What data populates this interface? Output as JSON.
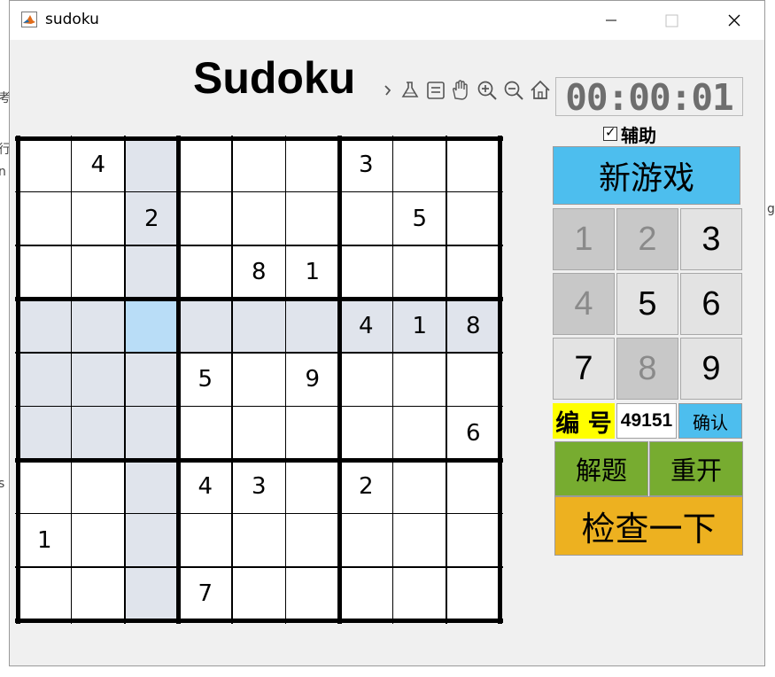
{
  "window": {
    "title": "sudoku"
  },
  "background": {
    "fragments": [
      "考",
      "行",
      "n",
      "go",
      "s"
    ]
  },
  "heading": "Sudoku",
  "timer": "00:00:01",
  "assist": {
    "label": "辅助",
    "checked": true
  },
  "buttons": {
    "new_game": "新游戏",
    "confirm": "确认",
    "solve": "解题",
    "restart": "重开",
    "check": "检查一下"
  },
  "puzzle_id": {
    "label": "编 号",
    "value": "49151"
  },
  "numpad": [
    {
      "label": "1",
      "enabled": false
    },
    {
      "label": "2",
      "enabled": false
    },
    {
      "label": "3",
      "enabled": true
    },
    {
      "label": "4",
      "enabled": false
    },
    {
      "label": "5",
      "enabled": true
    },
    {
      "label": "6",
      "enabled": true
    },
    {
      "label": "7",
      "enabled": true
    },
    {
      "label": "8",
      "enabled": false
    },
    {
      "label": "9",
      "enabled": true
    }
  ],
  "board": [
    [
      "",
      "4",
      "",
      "",
      "",
      "",
      "3",
      "",
      ""
    ],
    [
      "",
      "",
      "2",
      "",
      "",
      "",
      "",
      "5",
      ""
    ],
    [
      "",
      "",
      "",
      "",
      "8",
      "1",
      "",
      "",
      ""
    ],
    [
      "",
      "",
      "",
      "",
      "",
      "",
      "4",
      "1",
      "8"
    ],
    [
      "",
      "",
      "",
      "5",
      "",
      "9",
      "",
      "",
      ""
    ],
    [
      "",
      "",
      "",
      "",
      "",
      "",
      "",
      "",
      "6"
    ],
    [
      "",
      "",
      "",
      "4",
      "3",
      "",
      "2",
      "",
      ""
    ],
    [
      "1",
      "",
      "",
      "",
      "",
      "",
      "",
      "",
      ""
    ],
    [
      "",
      "",
      "",
      "7",
      "",
      "",
      "",
      "",
      ""
    ]
  ],
  "selected_cell": {
    "row": 3,
    "col": 2
  },
  "toolbar_icons": [
    "brush-icon",
    "data-cursor-icon",
    "pan-icon",
    "zoom-in-icon",
    "zoom-out-icon",
    "home-icon"
  ],
  "colors": {
    "highlight": "#e0e4ec",
    "selected": "#b9ddf7",
    "new_game": "#4dbeee",
    "solve": "#77ac30",
    "check": "#edb120",
    "id_label": "#ffff00"
  }
}
